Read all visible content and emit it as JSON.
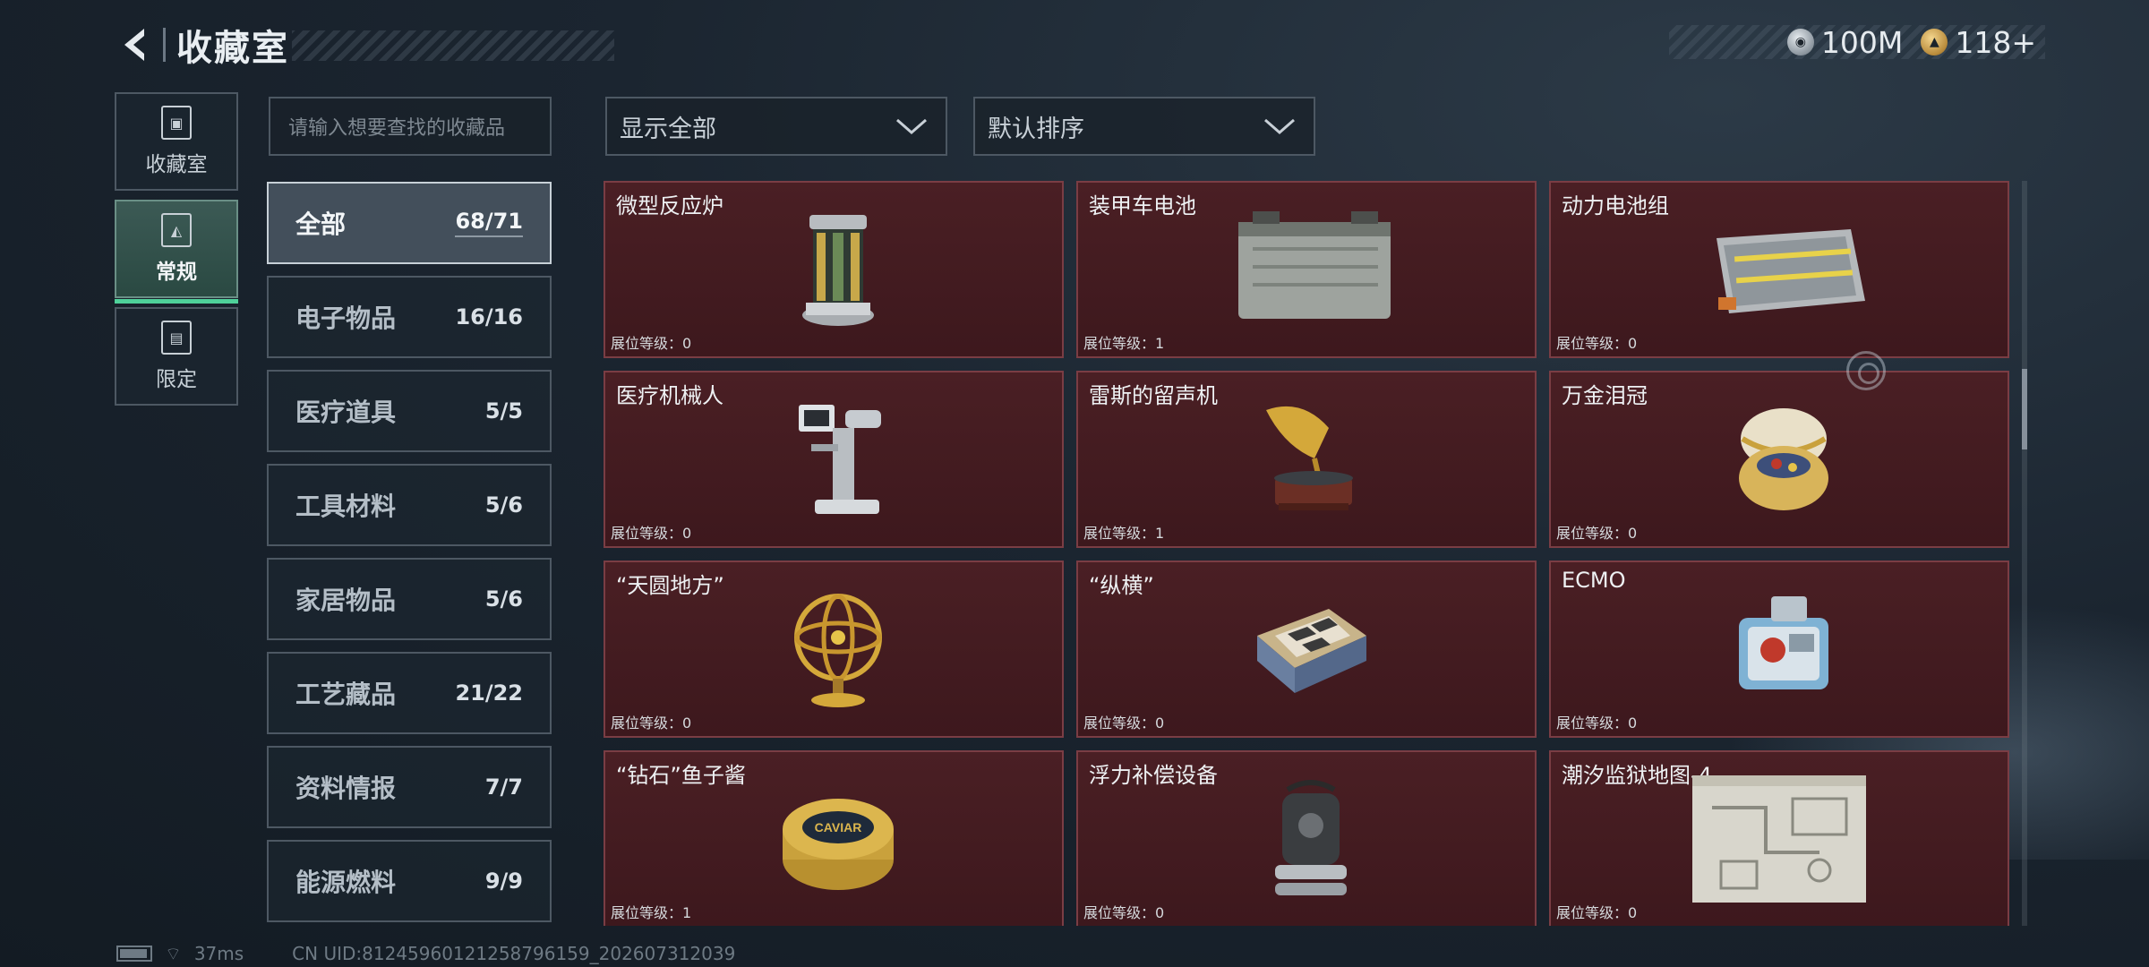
{
  "header": {
    "title": "收藏室",
    "currencies": [
      {
        "icon": "silver-coin-icon",
        "value": "100M"
      },
      {
        "icon": "gold-coin-icon",
        "value": "118+"
      }
    ]
  },
  "left_tabs": [
    {
      "label": "收藏室",
      "icon": "collection-room-icon",
      "active": false
    },
    {
      "label": "常规",
      "icon": "regular-icon",
      "active": true
    },
    {
      "label": "限定",
      "icon": "limited-icon",
      "active": false
    }
  ],
  "search": {
    "placeholder": "请输入想要查找的收藏品"
  },
  "filters": {
    "show": "显示全部",
    "sort": "默认排序"
  },
  "categories": [
    {
      "name": "全部",
      "count": "68/71",
      "active": true
    },
    {
      "name": "电子物品",
      "count": "16/16"
    },
    {
      "name": "医疗道具",
      "count": "5/5"
    },
    {
      "name": "工具材料",
      "count": "5/6"
    },
    {
      "name": "家居物品",
      "count": "5/6"
    },
    {
      "name": "工艺藏品",
      "count": "21/22"
    },
    {
      "name": "资料情报",
      "count": "7/7"
    },
    {
      "name": "能源燃料",
      "count": "9/9"
    }
  ],
  "items": [
    {
      "name": "微型反应炉",
      "level": "展位等级：0",
      "icon": "mini-reactor-icon"
    },
    {
      "name": "装甲车电池",
      "level": "展位等级：1",
      "icon": "armored-vehicle-battery-icon"
    },
    {
      "name": "动力电池组",
      "level": "展位等级：0",
      "icon": "power-battery-pack-icon"
    },
    {
      "name": "医疗机械人",
      "level": "展位等级：0",
      "icon": "medical-robot-icon"
    },
    {
      "name": "雷斯的留声机",
      "level": "展位等级：1",
      "icon": "gramophone-icon"
    },
    {
      "name": "万金泪冠",
      "level": "展位等级：0",
      "icon": "jeweled-egg-icon"
    },
    {
      "name": "“天圆地方”",
      "level": "展位等级：0",
      "icon": "armillary-sphere-icon"
    },
    {
      "name": "“纵横”",
      "level": "展位等级：0",
      "icon": "chess-box-icon"
    },
    {
      "name": "ECMO",
      "level": "展位等级：0",
      "icon": "ecmo-machine-icon"
    },
    {
      "name": "“钻石”鱼子酱",
      "level": "展位等级：1",
      "icon": "caviar-tin-icon"
    },
    {
      "name": "浮力补偿设备",
      "level": "展位等级：0",
      "icon": "buoyancy-device-icon"
    },
    {
      "name": "潮汐监狱地图-4",
      "level": "展位等级：0",
      "icon": "prison-map-icon"
    }
  ],
  "caviar_label": "CAVIAR",
  "status": {
    "ping": "37ms",
    "uid": "CN UID:81245960121258796159_202607312039"
  },
  "colors": {
    "card_bg": "#4a1f24",
    "accent_green": "#4fd19a",
    "card_border": "#7a3d44"
  }
}
